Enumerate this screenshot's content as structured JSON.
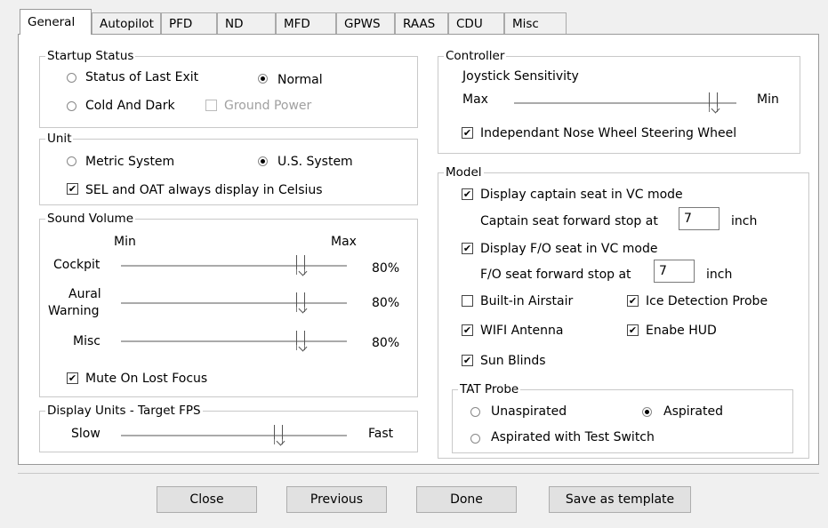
{
  "tabs": [
    "General",
    "Autopilot",
    "PFD",
    "ND",
    "MFD",
    "GPWS",
    "RAAS",
    "CDU",
    "Misc"
  ],
  "startup": {
    "legend": "Startup Status",
    "last_exit": "Status of Last Exit",
    "normal": "Normal",
    "cold_dark": "Cold And Dark",
    "ground_power": "Ground Power"
  },
  "unit": {
    "legend": "Unit",
    "metric": "Metric System",
    "us": "U.S. System",
    "celsius": "SEL and OAT always display in Celsius"
  },
  "sound": {
    "legend": "Sound Volume",
    "min": "Min",
    "max": "Max",
    "cockpit": "Cockpit",
    "aural_1": "Aural",
    "aural_2": "Warning",
    "misc": "Misc",
    "cockpit_value": "80%",
    "aural_value": "80%",
    "misc_value": "80%",
    "cockpit_level": 0.8,
    "aural_level": 0.8,
    "misc_level": 0.8,
    "mute": "Mute On Lost Focus"
  },
  "fps": {
    "legend": "Display Units - Target FPS",
    "slow": "Slow",
    "fast": "Fast",
    "level": 0.7
  },
  "controller": {
    "legend": "Controller",
    "joystick": "Joystick Sensitivity",
    "max": "Max",
    "min": "Min",
    "level": 0.9,
    "nose_wheel": "Independant Nose Wheel Steering Wheel"
  },
  "model": {
    "legend": "Model",
    "captain_seat": "Display captain seat in VC mode",
    "captain_stop": "Captain seat forward stop at",
    "captain_value": "7",
    "inch1": "inch",
    "fo_seat": "Display F/O seat in VC mode",
    "fo_stop": "F/O seat forward stop at",
    "fo_value": "7",
    "inch2": "inch",
    "airstair": "Built-in Airstair",
    "ice_probe": "Ice Detection Probe",
    "wifi": "WIFI Antenna",
    "hud": "Enabe HUD",
    "sun_blinds": "Sun Blinds"
  },
  "tat": {
    "legend": "TAT Probe",
    "unaspirated": "Unaspirated",
    "aspirated": "Aspirated",
    "test_switch": "Aspirated with Test Switch"
  },
  "buttons": {
    "close": "Close",
    "previous": "Previous",
    "done": "Done",
    "save": "Save as template"
  },
  "check_glyph": "✔"
}
